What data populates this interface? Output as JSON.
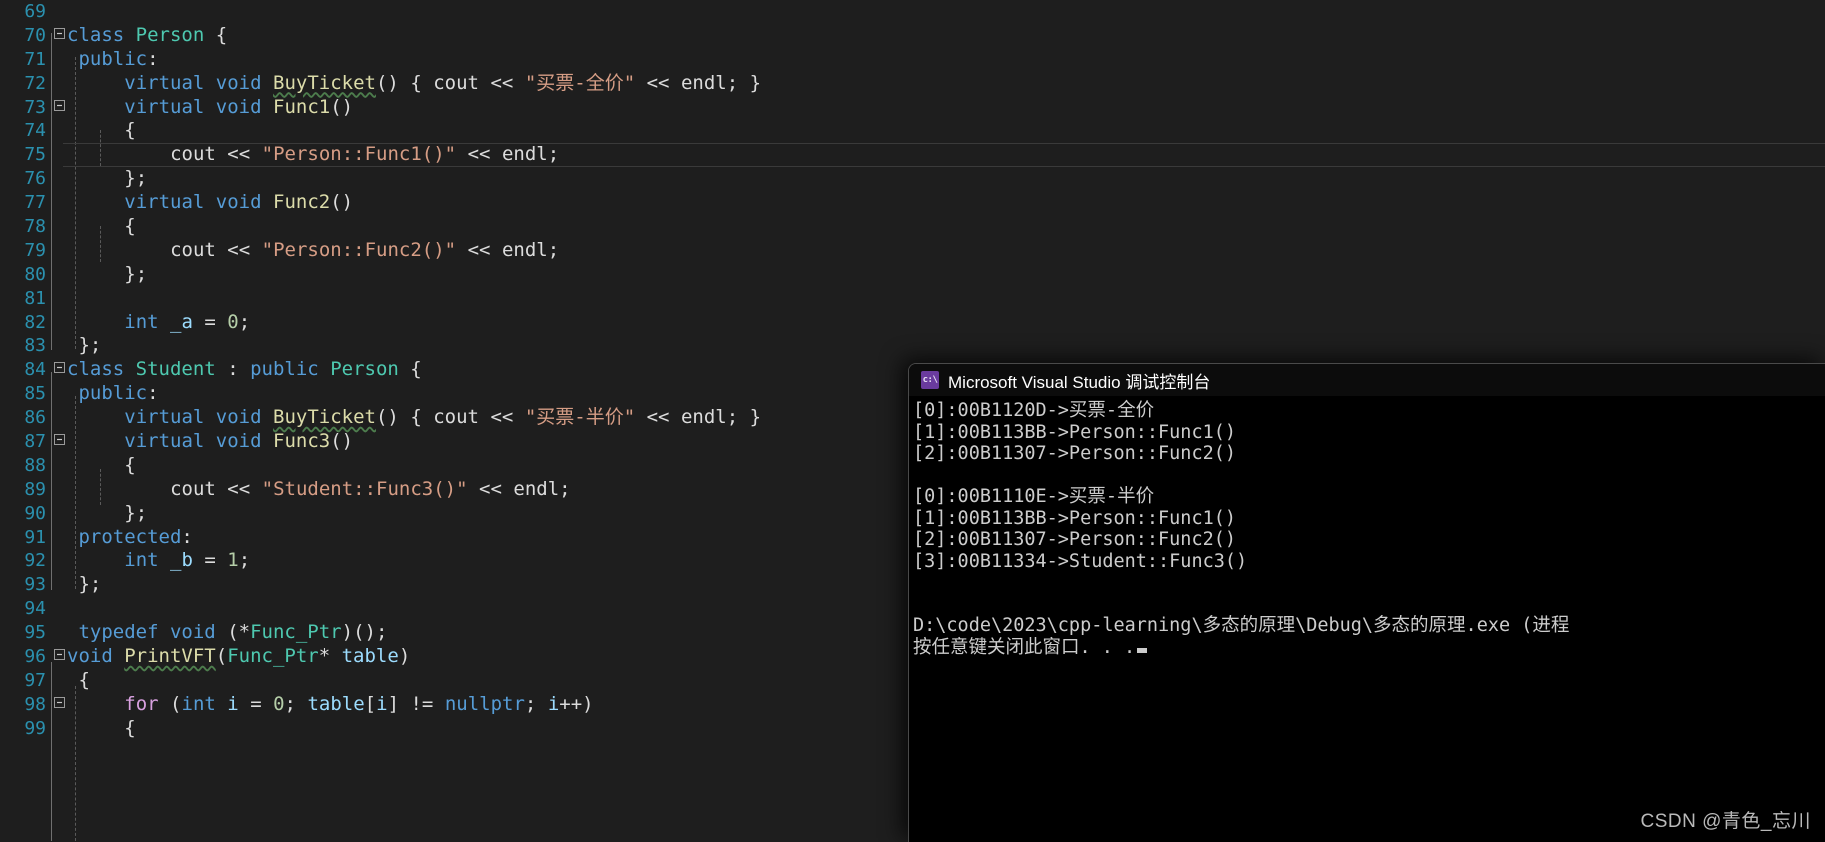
{
  "editor": {
    "theme_background": "#1e1e1e",
    "gutter_color": "#2b91af",
    "first_visible_line": 69,
    "lines": [
      {
        "num": "69",
        "fold": "",
        "text": ""
      },
      {
        "num": "70",
        "fold": "-",
        "text": "class Person {"
      },
      {
        "num": "71",
        "fold": "",
        "text": " public:"
      },
      {
        "num": "72",
        "fold": "",
        "text": "     virtual void BuyTicket() { cout << \"买票-全价\" << endl; }"
      },
      {
        "num": "73",
        "fold": "-",
        "text": "     virtual void Func1()"
      },
      {
        "num": "74",
        "fold": "",
        "text": "     {"
      },
      {
        "num": "75",
        "fold": "",
        "text": "         cout << \"Person::Func1()\" << endl;"
      },
      {
        "num": "76",
        "fold": "",
        "text": "     };"
      },
      {
        "num": "77",
        "fold": "",
        "text": "     virtual void Func2()"
      },
      {
        "num": "78",
        "fold": "",
        "text": "     {"
      },
      {
        "num": "79",
        "fold": "",
        "text": "         cout << \"Person::Func2()\" << endl;"
      },
      {
        "num": "80",
        "fold": "",
        "text": "     };"
      },
      {
        "num": "81",
        "fold": "",
        "text": ""
      },
      {
        "num": "82",
        "fold": "",
        "text": "     int _a = 0;"
      },
      {
        "num": "83",
        "fold": "",
        "text": " };"
      },
      {
        "num": "84",
        "fold": "-",
        "text": "class Student : public Person {"
      },
      {
        "num": "85",
        "fold": "",
        "text": " public:"
      },
      {
        "num": "86",
        "fold": "",
        "text": "     virtual void BuyTicket() { cout << \"买票-半价\" << endl; }"
      },
      {
        "num": "87",
        "fold": "-",
        "text": "     virtual void Func3()"
      },
      {
        "num": "88",
        "fold": "",
        "text": "     {"
      },
      {
        "num": "89",
        "fold": "",
        "text": "         cout << \"Student::Func3()\" << endl;"
      },
      {
        "num": "90",
        "fold": "",
        "text": "     };"
      },
      {
        "num": "91",
        "fold": "",
        "text": " protected:"
      },
      {
        "num": "92",
        "fold": "",
        "text": "     int _b = 1;"
      },
      {
        "num": "93",
        "fold": "",
        "text": " };"
      },
      {
        "num": "94",
        "fold": "",
        "text": ""
      },
      {
        "num": "95",
        "fold": "",
        "text": " typedef void (*Func_Ptr)();"
      },
      {
        "num": "96",
        "fold": "-",
        "text": "void PrintVFT(Func_Ptr* table)"
      },
      {
        "num": "97",
        "fold": "",
        "text": " {"
      },
      {
        "num": "98",
        "fold": "-",
        "text": "     for (int i = 0; table[i] != nullptr; i++)"
      },
      {
        "num": "99",
        "fold": "",
        "text": "     {"
      }
    ],
    "current_line": "75"
  },
  "console": {
    "title": "Microsoft Visual Studio 调试控制台",
    "icon": "console-window-icon",
    "icon_glyph": "c:\\",
    "output_lines": [
      "[0]:00B1120D->买票-全价",
      "[1]:00B113BB->Person::Func1()",
      "[2]:00B11307->Person::Func2()",
      "",
      "[0]:00B1110E->买票-半价",
      "[1]:00B113BB->Person::Func1()",
      "[2]:00B11307->Person::Func2()",
      "[3]:00B11334->Student::Func3()",
      "",
      "",
      "D:\\code\\2023\\cpp-learning\\多态的原理\\Debug\\多态的原理.exe (进程",
      "按任意键关闭此窗口. . ."
    ],
    "cursor": "block-cursor"
  },
  "watermark": {
    "text": "CSDN @青色_忘川"
  }
}
